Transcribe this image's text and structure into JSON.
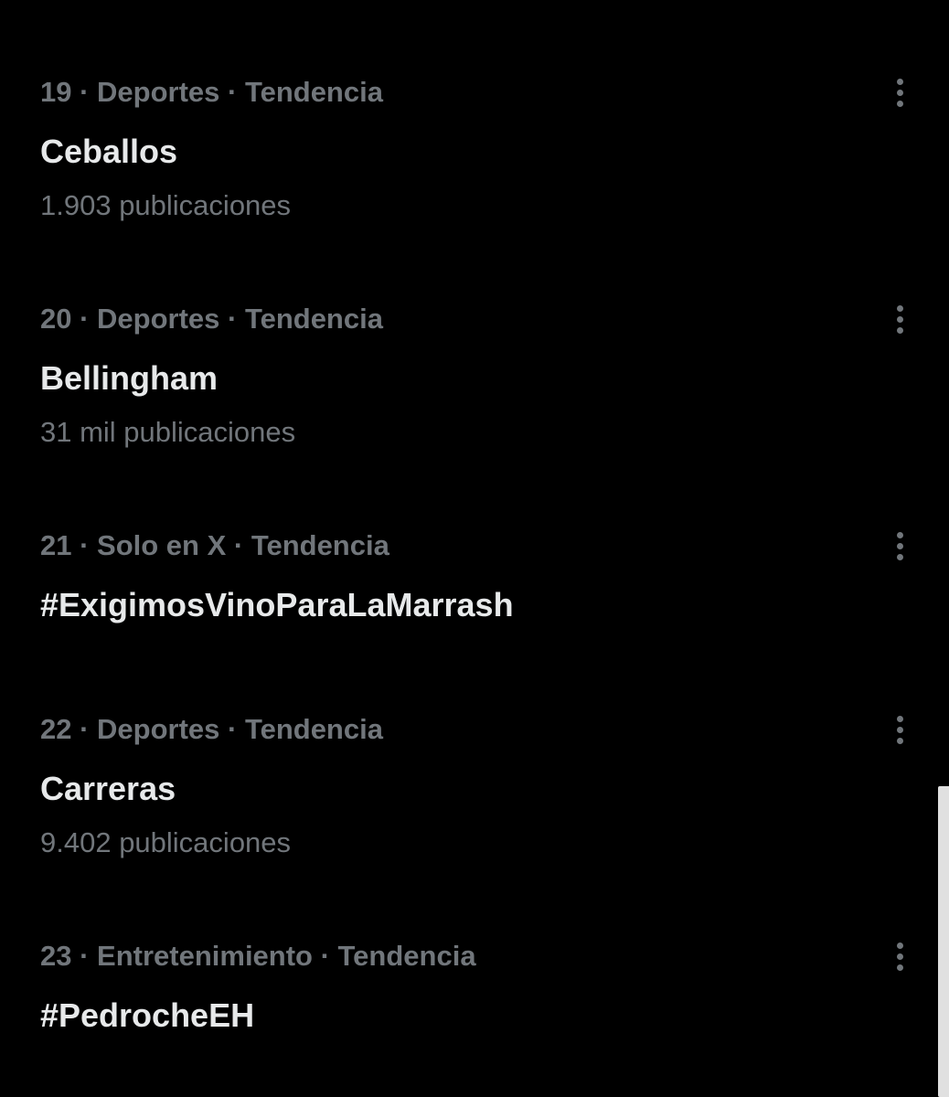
{
  "trends": [
    {
      "meta": "19 · Deportes · Tendencia",
      "title": "Ceballos",
      "count": "1.903 publicaciones"
    },
    {
      "meta": "20 · Deportes · Tendencia",
      "title": "Bellingham",
      "count": "31 mil publicaciones"
    },
    {
      "meta": "21 · Solo en X · Tendencia",
      "title": "#ExigimosVinoParaLaMarrash",
      "count": ""
    },
    {
      "meta": "22 · Deportes · Tendencia",
      "title": "Carreras",
      "count": "9.402 publicaciones"
    },
    {
      "meta": "23 · Entretenimiento · Tendencia",
      "title": "#PedrocheEH",
      "count": ""
    }
  ],
  "icons": {
    "more": "more-vertical-icon"
  },
  "colors": {
    "background": "#000000",
    "primary_text": "#e7e9ea",
    "secondary_text": "#71767b"
  }
}
